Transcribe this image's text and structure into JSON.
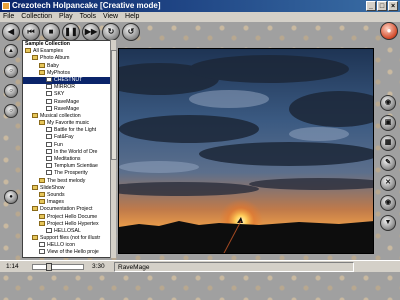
{
  "window": {
    "title": "Crezotech Holpancake [Creative mode]"
  },
  "menu": [
    "File",
    "Collection",
    "Play",
    "Tools",
    "View",
    "Help"
  ],
  "toolbar": {
    "buttons": [
      "back",
      "rewind",
      "stop",
      "pause",
      "forward",
      "refresh",
      "repeat"
    ]
  },
  "tree": {
    "title": "Sample Collection",
    "items": [
      {
        "label": "All Examples",
        "icon": "folder",
        "level": 0
      },
      {
        "label": "Photo Album",
        "icon": "folder",
        "level": 1
      },
      {
        "label": "Baby",
        "icon": "folder",
        "level": 2
      },
      {
        "label": "MyPhotos",
        "icon": "folder",
        "level": 2
      },
      {
        "label": "CHESTNUT",
        "icon": "doc",
        "level": 3,
        "selected": true
      },
      {
        "label": "MIRROR",
        "icon": "doc",
        "level": 3
      },
      {
        "label": "SKY",
        "icon": "doc",
        "level": 3
      },
      {
        "label": "RaveMage",
        "icon": "doc",
        "level": 3
      },
      {
        "label": "RaveMage",
        "icon": "doc",
        "level": 3
      },
      {
        "label": "Musical collection",
        "icon": "folder",
        "level": 1
      },
      {
        "label": "My Favorite music",
        "icon": "folder",
        "level": 2
      },
      {
        "label": "Battle for the Light",
        "icon": "doc",
        "level": 3
      },
      {
        "label": "Fat&Fay",
        "icon": "doc",
        "level": 3
      },
      {
        "label": "Fun",
        "icon": "doc",
        "level": 3
      },
      {
        "label": "In the World of Dre",
        "icon": "doc",
        "level": 3
      },
      {
        "label": "Meditations",
        "icon": "doc",
        "level": 3
      },
      {
        "label": "Templum Scientiae",
        "icon": "doc",
        "level": 3
      },
      {
        "label": "The Prosperity",
        "icon": "doc",
        "level": 3
      },
      {
        "label": "The best melody",
        "icon": "folder",
        "level": 2
      },
      {
        "label": "SlideShow",
        "icon": "folder",
        "level": 1
      },
      {
        "label": "Sounds",
        "icon": "folder",
        "level": 2
      },
      {
        "label": "Images",
        "icon": "folder",
        "level": 2
      },
      {
        "label": "Documentation Project",
        "icon": "folder",
        "level": 1
      },
      {
        "label": "Project Hello Docume",
        "icon": "folder",
        "level": 2
      },
      {
        "label": "Project Hello Hypertex",
        "icon": "folder",
        "level": 2
      },
      {
        "label": "HELLOSAL",
        "icon": "doc",
        "level": 3
      },
      {
        "label": "Support files (not for illustr",
        "icon": "folder",
        "level": 1
      },
      {
        "label": "HELLO icon",
        "icon": "doc",
        "level": 2
      },
      {
        "label": "View of the Hello proje",
        "icon": "doc",
        "level": 2
      }
    ]
  },
  "status": {
    "current_time": "1:14",
    "total_time": "3:30",
    "current_item": "RaveMage",
    "position_fraction": 0.3
  }
}
